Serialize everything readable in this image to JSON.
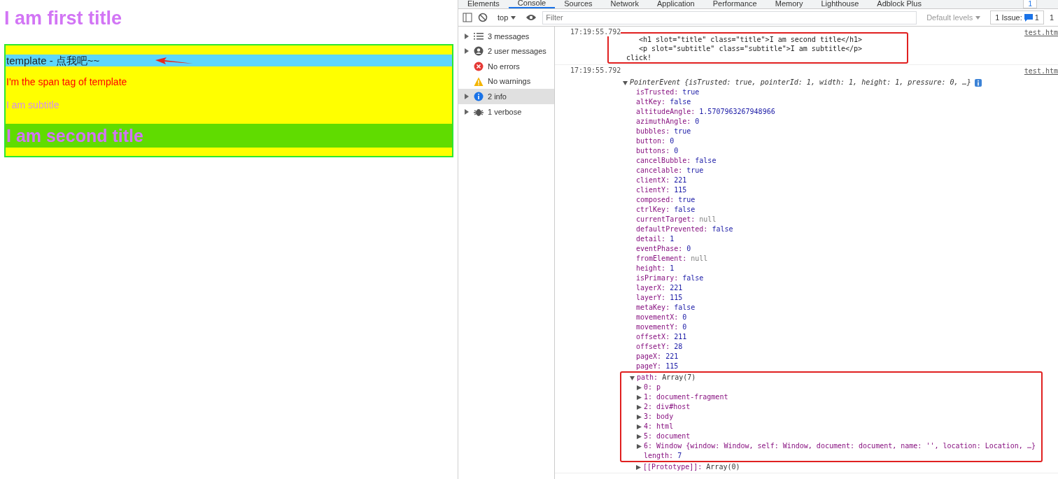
{
  "page": {
    "first_title": "I am first title",
    "host": {
      "template_label": "template - 点我吧~~",
      "span_text": "I'm the span tag of template",
      "subtitle": "I am subtitle",
      "second_title": "I am second title"
    }
  },
  "devtools": {
    "tabs": [
      {
        "label": "Elements",
        "selected": false
      },
      {
        "label": "Console",
        "selected": true
      },
      {
        "label": "Sources",
        "selected": false
      },
      {
        "label": "Network",
        "selected": false
      },
      {
        "label": "Application",
        "selected": false
      },
      {
        "label": "Performance",
        "selected": false
      },
      {
        "label": "Memory",
        "selected": false
      },
      {
        "label": "Lighthouse",
        "selected": false
      },
      {
        "label": "Adblock Plus",
        "selected": false
      }
    ],
    "message_badge": "1",
    "toolbar": {
      "context": "top",
      "filter_placeholder": "Filter",
      "levels": "Default levels",
      "issues_label": "1 Issue:",
      "issues_count": "1",
      "extra": "1"
    },
    "sidebar": [
      {
        "label": "3 messages",
        "kind": "list",
        "expandable": true,
        "selected": false
      },
      {
        "label": "2 user messages",
        "kind": "user",
        "expandable": true,
        "selected": false
      },
      {
        "label": "No errors",
        "kind": "error",
        "expandable": false,
        "selected": false
      },
      {
        "label": "No warnings",
        "kind": "warning",
        "expandable": false,
        "selected": false
      },
      {
        "label": "2 info",
        "kind": "info",
        "expandable": true,
        "selected": true
      },
      {
        "label": "1 verbose",
        "kind": "verbose",
        "expandable": true,
        "selected": false
      }
    ],
    "log": [
      {
        "kind": "text",
        "time": "17:19:55.792",
        "source": "test.htm",
        "highlighted": true,
        "lines": [
          {
            "text": "<h1 slot=\"title\" class=\"title\">I am second title</h1>",
            "indented": true
          },
          {
            "text": "<p slot=\"subtitle\" class=\"subtitle\">I am subtitle</p>",
            "indented": true
          },
          {
            "text": "click!",
            "indented": false
          }
        ]
      },
      {
        "kind": "object",
        "time": "17:19:55.792",
        "source": "test.htm",
        "summary": "PointerEvent {isTrusted: true, pointerId: 1, width: 1, height: 1, pressure: 0, …}",
        "expanded": true,
        "properties": [
          {
            "key": "isTrusted:",
            "value": "true",
            "greyed": false
          },
          {
            "key": "altKey:",
            "value": "false",
            "greyed": false
          },
          {
            "key": "altitudeAngle:",
            "value": "1.5707963267948966",
            "greyed": false
          },
          {
            "key": "azimuthAngle:",
            "value": "0",
            "greyed": false
          },
          {
            "key": "bubbles:",
            "value": "true",
            "greyed": false
          },
          {
            "key": "button:",
            "value": "0",
            "greyed": false
          },
          {
            "key": "buttons:",
            "value": "0",
            "greyed": false
          },
          {
            "key": "cancelBubble:",
            "value": "false",
            "greyed": false
          },
          {
            "key": "cancelable:",
            "value": "true",
            "greyed": false
          },
          {
            "key": "clientX:",
            "value": "221",
            "greyed": false
          },
          {
            "key": "clientY:",
            "value": "115",
            "greyed": false
          },
          {
            "key": "composed:",
            "value": "true",
            "greyed": false
          },
          {
            "key": "ctrlKey:",
            "value": "false",
            "greyed": false
          },
          {
            "key": "currentTarget:",
            "value": "null",
            "greyed": true
          },
          {
            "key": "defaultPrevented:",
            "value": "false",
            "greyed": false
          },
          {
            "key": "detail:",
            "value": "1",
            "greyed": false
          },
          {
            "key": "eventPhase:",
            "value": "0",
            "greyed": false
          },
          {
            "key": "fromElement:",
            "value": "null",
            "greyed": true
          },
          {
            "key": "height:",
            "value": "1",
            "greyed": false
          },
          {
            "key": "isPrimary:",
            "value": "false",
            "greyed": false
          },
          {
            "key": "layerX:",
            "value": "221",
            "greyed": false
          },
          {
            "key": "layerY:",
            "value": "115",
            "greyed": false
          },
          {
            "key": "metaKey:",
            "value": "false",
            "greyed": false
          },
          {
            "key": "movementX:",
            "value": "0",
            "greyed": false
          },
          {
            "key": "movementY:",
            "value": "0",
            "greyed": false
          },
          {
            "key": "offsetX:",
            "value": "211",
            "greyed": false
          },
          {
            "key": "offsetY:",
            "value": "28",
            "greyed": false
          },
          {
            "key": "pageX:",
            "value": "221",
            "greyed": false
          },
          {
            "key": "pageY:",
            "value": "115",
            "greyed": false
          }
        ],
        "path": {
          "key": "path:",
          "value": "Array(7)",
          "expanded": true,
          "highlighted": true,
          "items": [
            {
              "key": "0:",
              "value": "p"
            },
            {
              "key": "1:",
              "value": "document-fragment"
            },
            {
              "key": "2:",
              "value": "div#host"
            },
            {
              "key": "3:",
              "value": "body"
            },
            {
              "key": "4:",
              "value": "html"
            },
            {
              "key": "5:",
              "value": "document"
            },
            {
              "key": "6:",
              "value": "Window {window: Window, self: Window, document: document, name: '', location: Location, …}"
            }
          ],
          "length_key": "length:",
          "length": "7"
        },
        "prototype": {
          "key": "[[Prototype]]:",
          "value": "Array(0)"
        }
      }
    ]
  }
}
